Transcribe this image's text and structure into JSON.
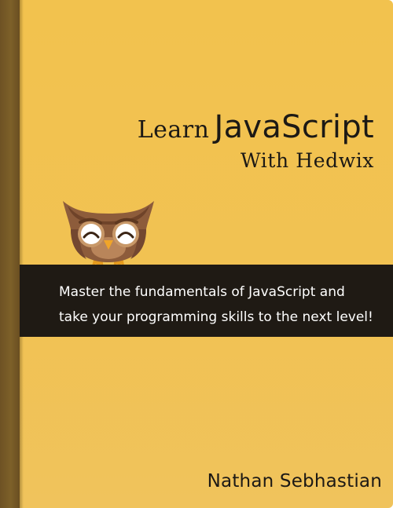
{
  "cover": {
    "title_prefix": "Learn",
    "title_main": "JavaScript",
    "subtitle": "With Hedwix",
    "tagline_line1": "Master the fundamentals of JavaScript and",
    "tagline_line2": "take your programming skills to the next level!",
    "author": "Nathan Sebhastian",
    "mascot_icon": "owl-mascot-icon"
  },
  "colors": {
    "cover": "#f2c24e",
    "spine": "#765a27",
    "band": "#1f1a14",
    "text_dark": "#1c1915",
    "text_light": "#ffffff",
    "owl_body": "#8c5b3a"
  }
}
